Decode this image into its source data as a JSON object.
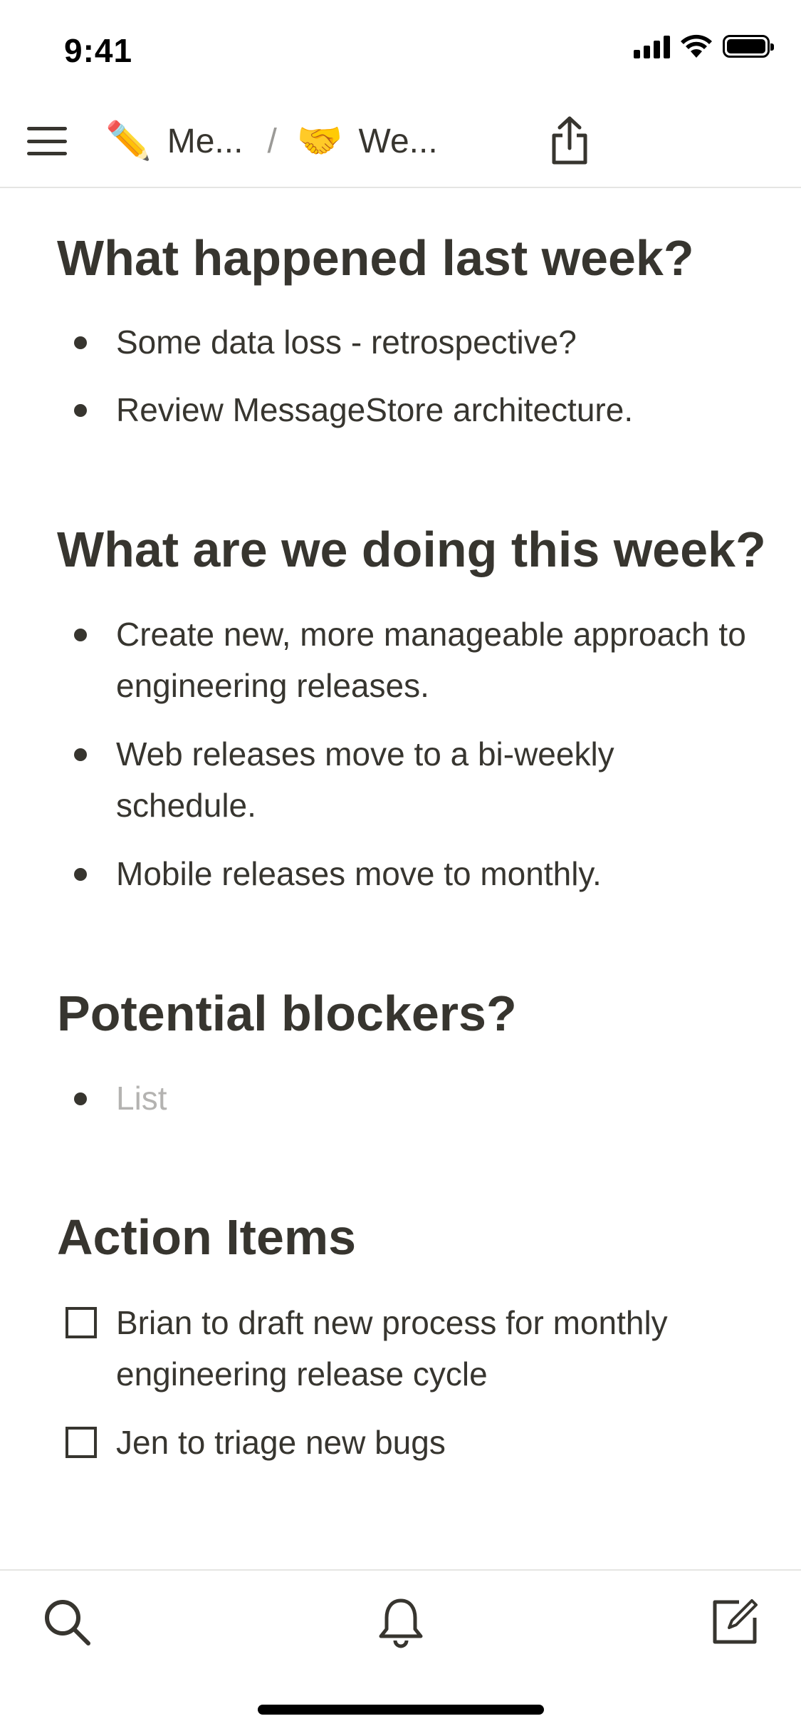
{
  "status_bar": {
    "time": "9:41",
    "icons": [
      "cellular-signal-icon",
      "wifi-icon",
      "battery-icon"
    ]
  },
  "nav": {
    "menu_icon": "hamburger-menu-icon",
    "breadcrumb": [
      {
        "emoji": "✏️",
        "label": "Me..."
      },
      {
        "emoji": "🤝",
        "label": "We..."
      }
    ],
    "separator": "/",
    "share_icon": "share-icon"
  },
  "sections": [
    {
      "heading": "What happened last week?",
      "items": [
        "Some data loss - retrospective?",
        "Review MessageStore architecture."
      ]
    },
    {
      "heading": "What are we doing this week?",
      "items": [
        "Create new, more manageable approach to engineering releases.",
        "Web releases move to a bi-weekly schedule.",
        "Mobile releases move to monthly."
      ]
    },
    {
      "heading": "Potential blockers?",
      "placeholder": "List"
    },
    {
      "heading": "Action Items",
      "todos": [
        {
          "text": "Brian to draft new process for monthly engineering release cycle",
          "checked": false
        },
        {
          "text": "Jen to triage new bugs",
          "checked": false
        }
      ]
    }
  ],
  "toolbar": {
    "icons": [
      "search-icon",
      "bell-icon",
      "compose-icon"
    ]
  },
  "colors": {
    "text": "#37352f",
    "placeholder": "#9b9a97",
    "divider": "#e5e5e3",
    "background": "#ffffff"
  }
}
